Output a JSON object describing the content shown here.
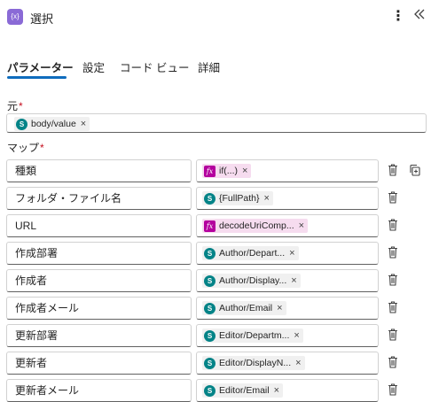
{
  "header": {
    "icon_label": "{x}",
    "title": "選択",
    "more_icon": "more-vertical-icon",
    "collapse_icon": "double-chevron-left-icon"
  },
  "tabs": [
    {
      "label": "パラメーター",
      "active": true
    },
    {
      "label": "設定",
      "active": false
    },
    {
      "label": "コード ビュー",
      "active": false
    },
    {
      "label": "詳細",
      "active": false
    }
  ],
  "from": {
    "label": "元",
    "required_mark": "*",
    "token": {
      "type": "sharepoint",
      "text": "body/value"
    }
  },
  "map": {
    "label": "マップ",
    "required_mark": "*",
    "rows": [
      {
        "key": "種類",
        "value": {
          "type": "expression",
          "text": "if(...)"
        }
      },
      {
        "key": "フォルダ・ファイル名",
        "value": {
          "type": "sharepoint",
          "text": "{FullPath}"
        }
      },
      {
        "key": "URL",
        "value": {
          "type": "expression",
          "text": "decodeUriComp..."
        }
      },
      {
        "key": "作成部署",
        "value": {
          "type": "sharepoint",
          "text": "Author/Depart..."
        }
      },
      {
        "key": "作成者",
        "value": {
          "type": "sharepoint",
          "text": "Author/Display..."
        }
      },
      {
        "key": "作成者メール",
        "value": {
          "type": "sharepoint",
          "text": "Author/Email"
        }
      },
      {
        "key": "更新部署",
        "value": {
          "type": "sharepoint",
          "text": "Editor/Departm..."
        }
      },
      {
        "key": "更新者",
        "value": {
          "type": "sharepoint",
          "text": "Editor/DisplayN..."
        }
      },
      {
        "key": "更新者メール",
        "value": {
          "type": "sharepoint",
          "text": "Editor/Email"
        }
      }
    ]
  },
  "icons": {
    "remove": "×",
    "sharepoint_glyph": "S",
    "expression_glyph": "fx"
  },
  "colors": {
    "accent": "#0f6cbd",
    "required": "#c50f1f",
    "sharepoint": "#038387",
    "expression": "#b4009e",
    "expression_token_bg": "#f6dcef"
  }
}
